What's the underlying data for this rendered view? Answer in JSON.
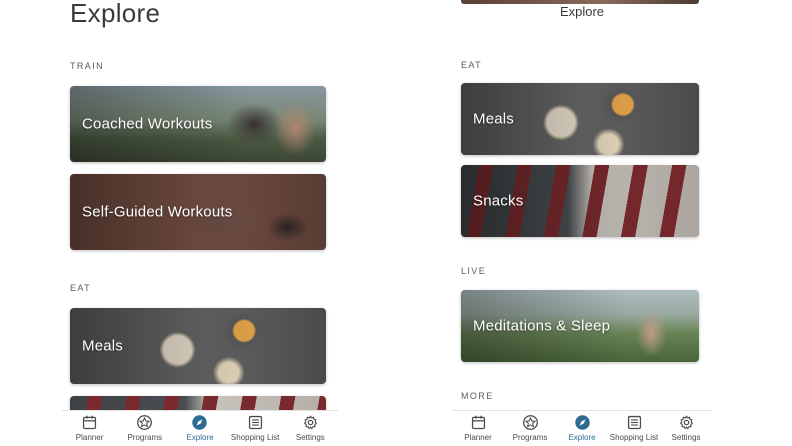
{
  "left_screen": {
    "title": "Explore",
    "sections": {
      "train": "TRAIN",
      "eat": "EAT"
    },
    "cards": {
      "coached": "Coached Workouts",
      "self_guided": "Self-Guided Workouts",
      "meals": "Meals"
    }
  },
  "right_screen": {
    "title": "Explore",
    "sections": {
      "eat": "EAT",
      "live": "LIVE",
      "more": "MORE"
    },
    "cards": {
      "meals": "Meals",
      "snacks": "Snacks",
      "meditations": "Meditations & Sleep"
    }
  },
  "nav": {
    "planner": "Planner",
    "programs": "Programs",
    "explore": "Explore",
    "shopping_list": "Shopping List",
    "settings": "Settings",
    "active": "Explore",
    "active_color": "#2c6c93",
    "inactive_color": "#4a4a4a"
  }
}
